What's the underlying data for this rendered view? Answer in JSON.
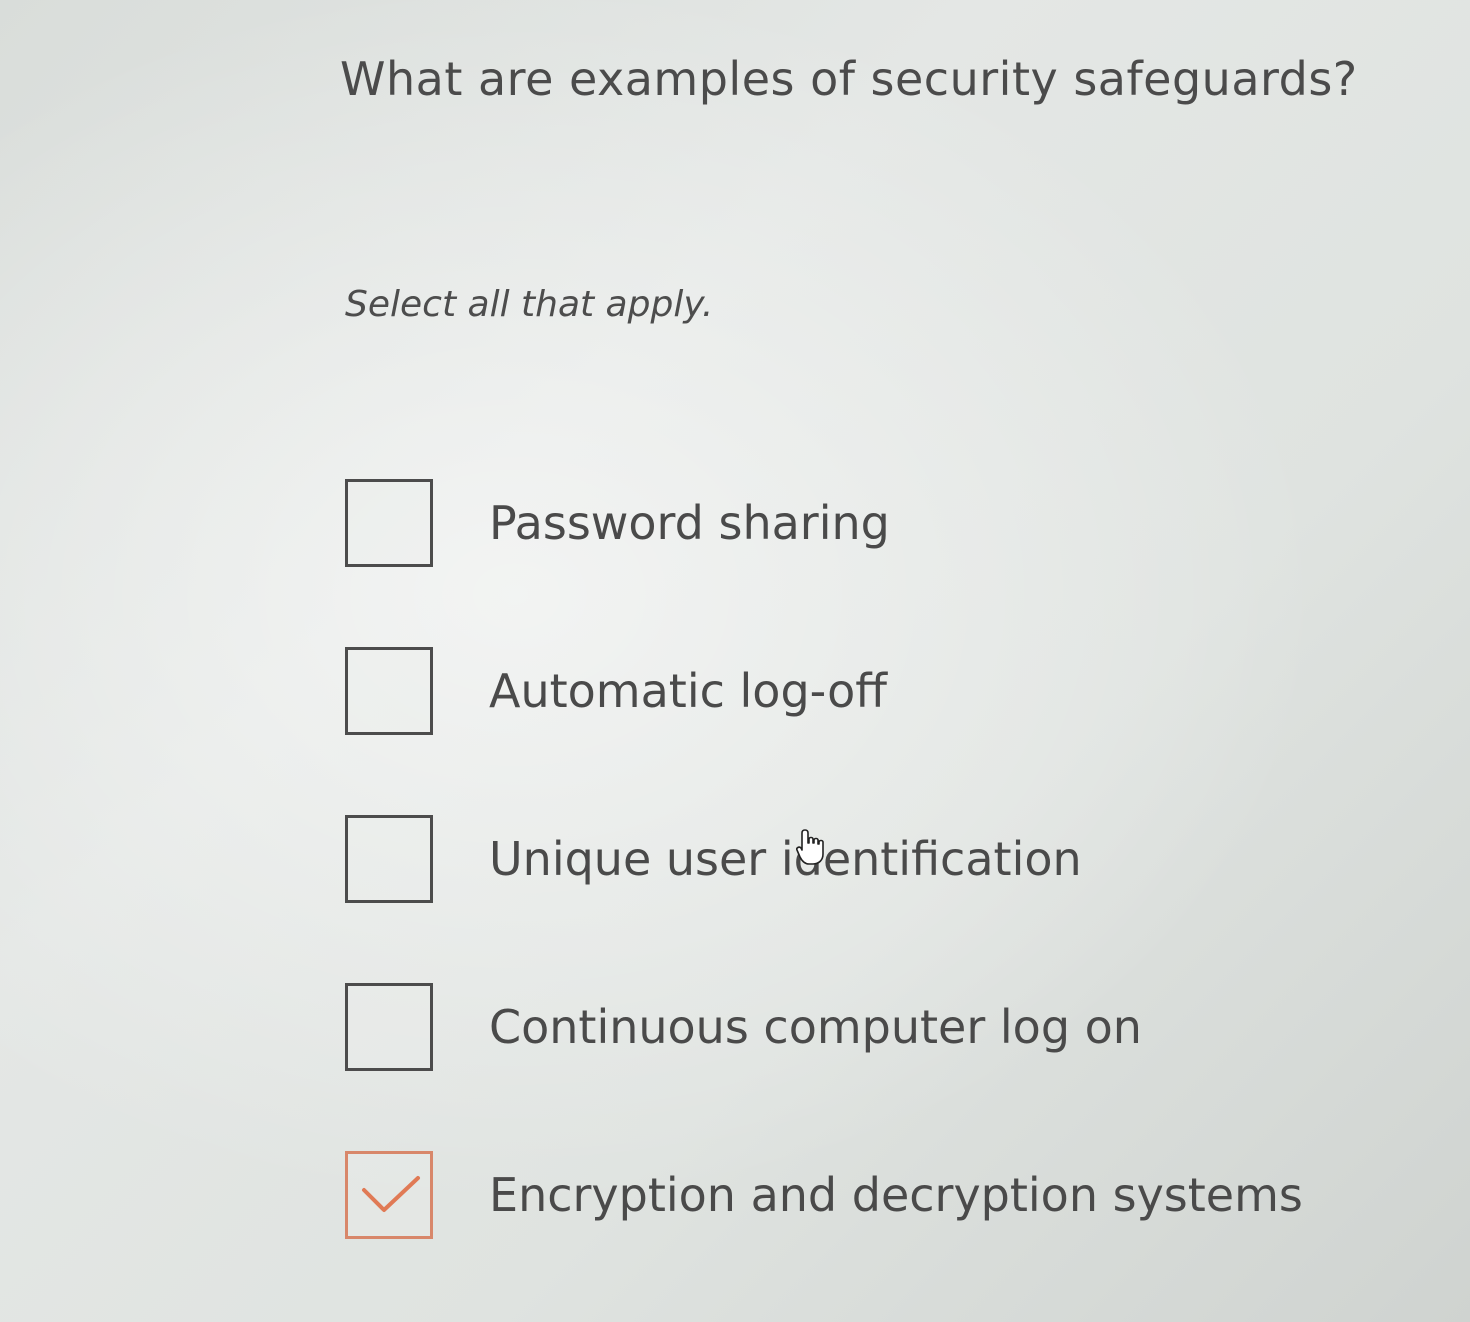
{
  "question": {
    "text": "What are examples of security safeguards?"
  },
  "instruction": {
    "text": "Select all that apply."
  },
  "options": [
    {
      "label": "Password sharing",
      "checked": false
    },
    {
      "label": "Automatic log-off",
      "checked": false
    },
    {
      "label": "Unique user identification",
      "checked": false
    },
    {
      "label": "Continuous computer log on",
      "checked": false
    },
    {
      "label": "Encryption and decryption systems",
      "checked": true
    }
  ],
  "colors": {
    "checkmark": "#e07a55",
    "checked_border": "#d8876a",
    "text": "#4a4a4a"
  },
  "icons": {
    "checkmark": "check-icon",
    "cursor": "hand-pointer-icon"
  }
}
